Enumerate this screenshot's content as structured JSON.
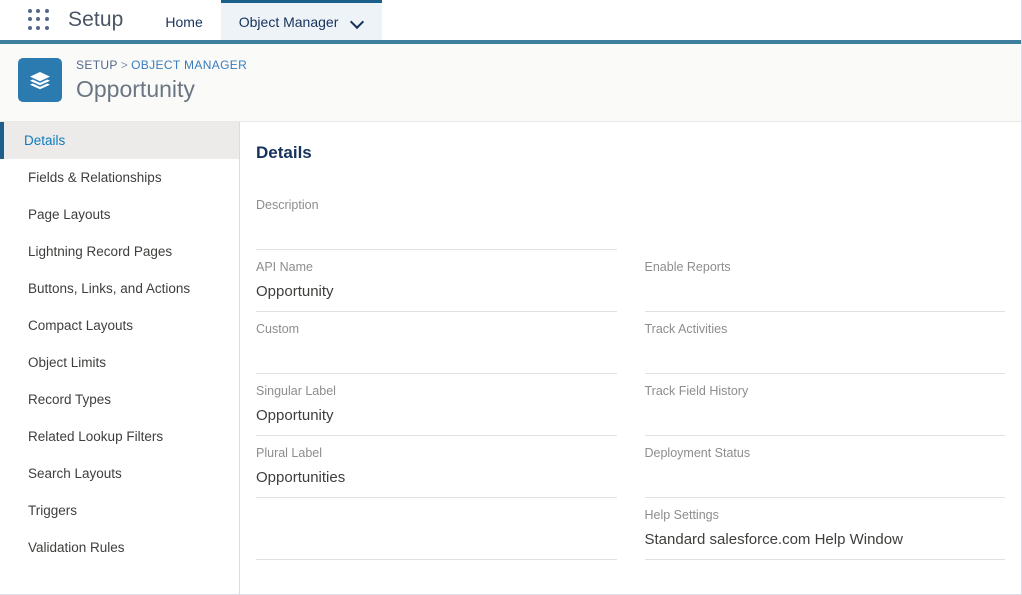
{
  "nav": {
    "app_launcher_icon": "app-launcher-waffle-icon",
    "setup_label": "Setup",
    "tabs": [
      {
        "label": "Home",
        "active": false,
        "has_chevron": false
      },
      {
        "label": "Object Manager",
        "active": true,
        "has_chevron": true
      }
    ]
  },
  "header": {
    "object_icon": "stacked-layers-icon",
    "breadcrumb": {
      "root": "SETUP",
      "separator": ">",
      "current": "OBJECT MANAGER"
    },
    "title": "Opportunity"
  },
  "sidebar": {
    "items": [
      {
        "label": "Details",
        "active": true
      },
      {
        "label": "Fields & Relationships",
        "active": false
      },
      {
        "label": "Page Layouts",
        "active": false
      },
      {
        "label": "Lightning Record Pages",
        "active": false
      },
      {
        "label": "Buttons, Links, and Actions",
        "active": false
      },
      {
        "label": "Compact Layouts",
        "active": false
      },
      {
        "label": "Object Limits",
        "active": false
      },
      {
        "label": "Record Types",
        "active": false
      },
      {
        "label": "Related Lookup Filters",
        "active": false
      },
      {
        "label": "Search Layouts",
        "active": false
      },
      {
        "label": "Triggers",
        "active": false
      },
      {
        "label": "Validation Rules",
        "active": false
      }
    ]
  },
  "main": {
    "section_title": "Details",
    "left_fields": [
      {
        "label": "Description",
        "value": ""
      },
      {
        "label": "API Name",
        "value": "Opportunity"
      },
      {
        "label": "Custom",
        "value": ""
      },
      {
        "label": "Singular Label",
        "value": "Opportunity"
      },
      {
        "label": "Plural Label",
        "value": "Opportunities"
      },
      {
        "label": "",
        "value": ""
      }
    ],
    "right_fields": [
      {
        "label": "Enable Reports",
        "value": ""
      },
      {
        "label": "Track Activities",
        "value": ""
      },
      {
        "label": "Track Field History",
        "value": ""
      },
      {
        "label": "Deployment Status",
        "value": ""
      },
      {
        "label": "Help Settings",
        "value": "Standard salesforce.com Help Window"
      }
    ]
  },
  "colors": {
    "brand_blue": "#1b5f8a",
    "nav_border": "#3e7f9e",
    "link_blue": "#3a7dbd",
    "icon_blue": "#2b7ab0",
    "header_bg": "#fafaf9",
    "active_item_bg": "#ecebea"
  }
}
